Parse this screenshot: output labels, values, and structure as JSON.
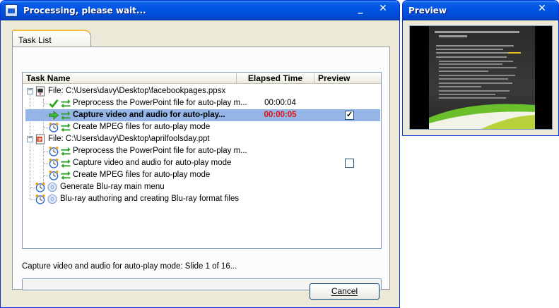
{
  "main_window": {
    "title": "Processing, please wait...",
    "controls": {
      "minimize": "_",
      "close": "✕"
    }
  },
  "tab": {
    "label": "Task List"
  },
  "columns": [
    "Task Name",
    "Elapsed Time",
    "Preview"
  ],
  "rows": [
    {
      "type": "file",
      "label": "File: C:\\Users\\davy\\Desktop\\facebookpages.ppsx"
    },
    {
      "type": "task",
      "label": "Preprocess the PowerPoint file for auto-play m...",
      "elapsed": "00:00:04",
      "status": "done"
    },
    {
      "type": "task",
      "label": "Capture video and audio for auto-play...",
      "elapsed": "00:00:05",
      "status": "running",
      "preview_checked": true
    },
    {
      "type": "task",
      "label": "Create MPEG files for auto-play mode",
      "status": "waiting"
    },
    {
      "type": "file",
      "label": "File: C:\\Users\\davy\\Desktop\\aprilfoolsday.ppt"
    },
    {
      "type": "task",
      "label": "Preprocess the PowerPoint file for auto-play m...",
      "status": "waiting"
    },
    {
      "type": "task",
      "label": "Capture video and audio for auto-play mode",
      "status": "waiting",
      "preview_checked": false
    },
    {
      "type": "task",
      "label": "Create MPEG files for auto-play mode",
      "status": "waiting"
    },
    {
      "type": "global",
      "label": "Generate Blu-ray main menu",
      "status": "waiting"
    },
    {
      "type": "global",
      "label": "Blu-ray authoring and creating Blu-ray format files",
      "status": "waiting"
    }
  ],
  "status_text": "Capture video and audio for auto-play mode: Slide 1 of 16...",
  "progress": 0,
  "cancel_label": "Cancel",
  "preview_window": {
    "title": "Preview",
    "controls": {
      "close": "✕"
    }
  },
  "colors": {
    "title_bar": "#0054e3",
    "selection": "#95b5e8",
    "elapsed_running": "#e01010"
  },
  "icons": {
    "done": "checkmark-icon",
    "running": "arrow-right-icon",
    "waiting": "alarm-clock-icon",
    "step": "double-arrow-icon",
    "file_ppsx": "powerpoint-show-icon",
    "file_ppt": "powerpoint-file-icon",
    "disc": "disc-icon"
  }
}
